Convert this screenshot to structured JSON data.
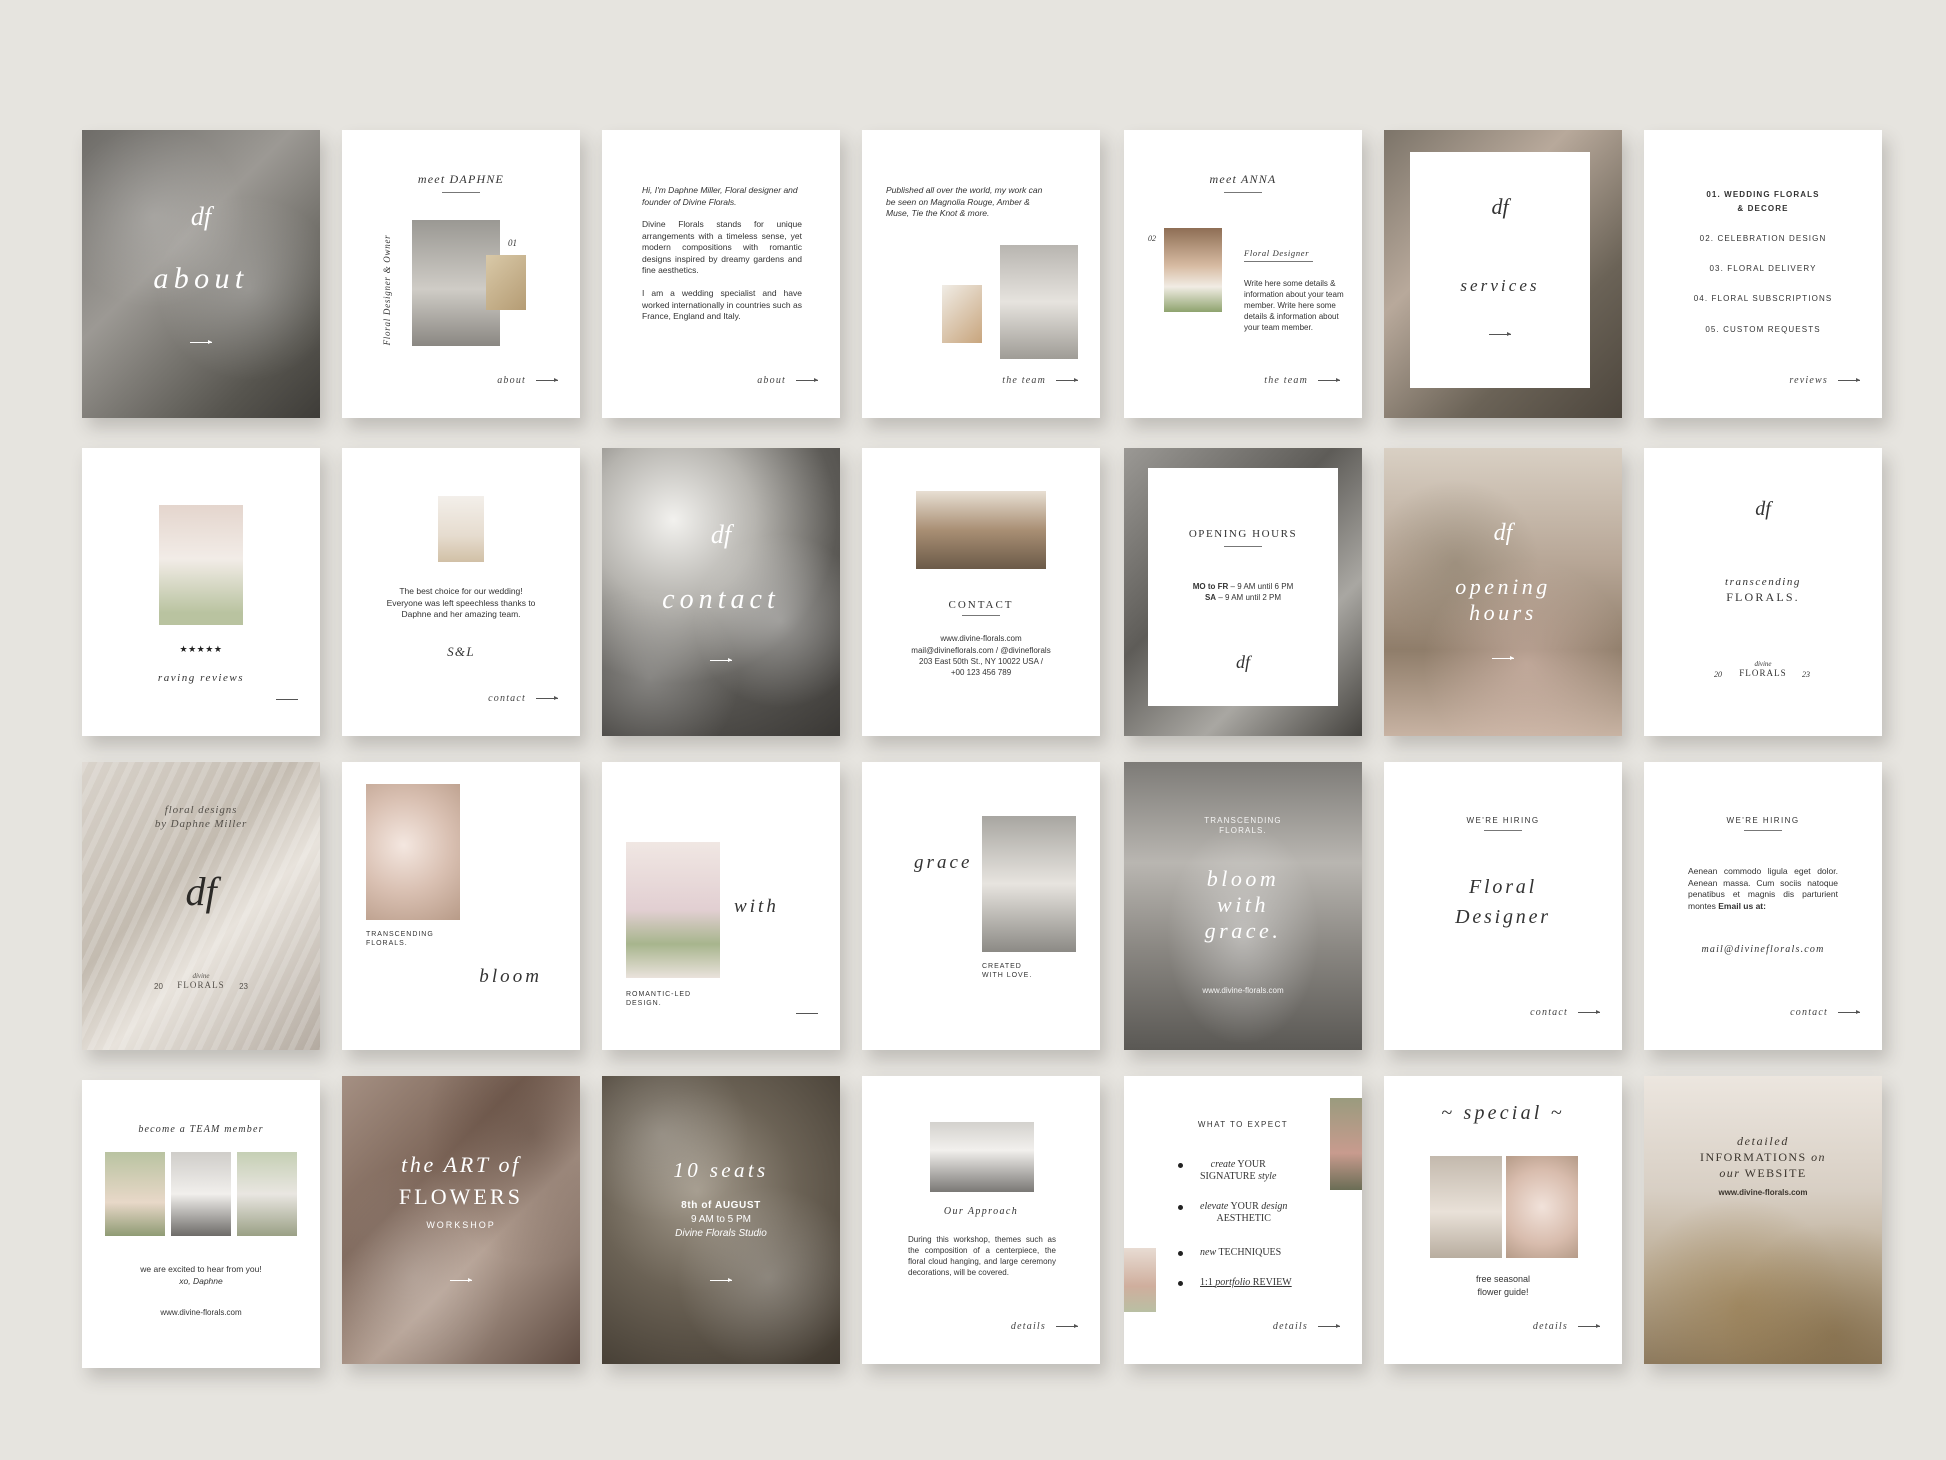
{
  "r1": {
    "c1": {
      "mono": "df",
      "title": "about"
    },
    "c2": {
      "title": "meet DAPHNE",
      "vertical": "Floral Designer & Owner",
      "num": "01",
      "footer": "about"
    },
    "c3": {
      "p1a": "Hi, I'm Daphne Miller, Floral designer and founder of Divine Florals.",
      "p2": "Divine Florals stands for unique arrangements with a timeless sense, yet modern compositions with romantic designs inspired by dreamy gardens and fine aesthetics.",
      "p3": "I am a wedding specialist and have worked internationally in countries such as France, England and Italy.",
      "footer": "about"
    },
    "c4": {
      "text": "Published all over the world, my work can be seen on Magnolia Rouge, Amber & Muse, Tie the Knot & more.",
      "footer": "the team"
    },
    "c5": {
      "title": "meet ANNA",
      "num": "02",
      "role": "Floral Designer",
      "text": "Write here some details & information about your team member. Write here some details & information about your team member.",
      "footer": "the team"
    },
    "c6": {
      "mono": "df",
      "title": "services"
    },
    "c7": {
      "l1": "01. WEDDING FLORALS",
      "l1b": "& DECORE",
      "l2": "02. CELEBRATION DESIGN",
      "l3": "03. FLORAL DELIVERY",
      "l4": "04. FLORAL SUBSCRIPTIONS",
      "l5": "05. CUSTOM REQUESTS",
      "footer": "reviews"
    }
  },
  "r2": {
    "c1": {
      "stars": "★★★★★",
      "title": "raving reviews"
    },
    "c2": {
      "text": "The best choice for our wedding! Everyone was left speechless thanks to Daphne and her amazing team.",
      "sig": "S&L",
      "footer": "contact"
    },
    "c3": {
      "mono": "df",
      "title": "contact"
    },
    "c4": {
      "title": "CONTACT",
      "l1": "www.divine-florals.com",
      "l2": "mail@divineflorals.com / @divineflorals",
      "l3": "203 East 50th St., NY 10022 USA /",
      "l4": "+00 123 456 789"
    },
    "c5": {
      "title": "OPENING HOURS",
      "l1b": "MO to FR",
      "l1": " – 9 AM until 6 PM",
      "l2b": "SA",
      "l2": " – 9 AM until 2 PM",
      "mono": "df"
    },
    "c6": {
      "mono": "df",
      "title1": "opening",
      "title2": "hours"
    },
    "c7": {
      "mono": "df",
      "l1": "transcending",
      "l2": "FLORALS.",
      "left": "20",
      "right": "23",
      "b1": "divine",
      "b2": "FLORALS"
    }
  },
  "r3": {
    "c1": {
      "l1": "floral designs",
      "l2": "by Daphne Miller",
      "mono": "df",
      "b1": "divine",
      "b2": "FLORALS",
      "left": "20",
      "right": "23"
    },
    "c2": {
      "cap1": "TRANSCENDING",
      "cap2": "FLORALS.",
      "word": "bloom"
    },
    "c3": {
      "word": "with",
      "cap1": "ROMANTIC-LED",
      "cap2": "DESIGN."
    },
    "c4": {
      "word": "grace",
      "cap1": "CREATED",
      "cap2": "WITH LOVE."
    },
    "c5": {
      "top1": "TRANSCENDING",
      "top2": "FLORALS.",
      "t1": "bloom",
      "t2": "with",
      "t3": "grace.",
      "url": "www.divine-florals.com"
    },
    "c6": {
      "head": "WE'RE HIRING",
      "t1": "Floral",
      "t2": "Designer",
      "footer": "contact"
    },
    "c7": {
      "head": "WE'RE HIRING",
      "text": "Aenean commodo ligula eget dolor. Aenean massa. Cum sociis natoque penatibus et magnis dis parturient montes",
      "bold": "Email us at:",
      "mail": "mail@divineflorals.com",
      "footer": "contact"
    }
  },
  "r4": {
    "c1": {
      "title": "become a TEAM member",
      "t1": "we are excited to hear from you!",
      "t2": "xo, Daphne",
      "url": "www.divine-florals.com"
    },
    "c2": {
      "t1": "the ART of",
      "t2": "FLOWERS",
      "t3": "WORKSHOP"
    },
    "c3": {
      "t1": "10 seats",
      "t2": "8th of AUGUST",
      "t3": "9 AM to 5 PM",
      "t4": "Divine Florals Studio"
    },
    "c4": {
      "title": "Our Approach",
      "text": "During this workshop, themes such as the composition of a centerpiece, the floral cloud hanging, and large ceremony decorations, will be covered.",
      "footer": "details"
    },
    "c5": {
      "head": "WHAT TO EXPECT",
      "i1a": "create",
      "i1b": "YOUR",
      "i1c": "SIGNATURE",
      "i1d": "style",
      "i2a": "elevate",
      "i2b": "YOUR",
      "i2c": "design",
      "i2d": "AESTHETIC",
      "i3a": "new",
      "i3b": "TECHNIQUES",
      "i4a": "1:1",
      "i4b": "portfolio",
      "i4c": "REVIEW",
      "footer": "details"
    },
    "c6": {
      "title": "~ special ~",
      "t1": "free seasonal",
      "t2": "flower guide!",
      "footer": "details"
    },
    "c7": {
      "t1": "detailed",
      "t2": "INFORMATIONS",
      "t2b": "on",
      "t3": "our",
      "t3b": "WEBSITE",
      "url": "www.divine-florals.com"
    }
  },
  "colors": {
    "background": "#e6e4df",
    "card": "#ffffff",
    "text": "#333333"
  }
}
